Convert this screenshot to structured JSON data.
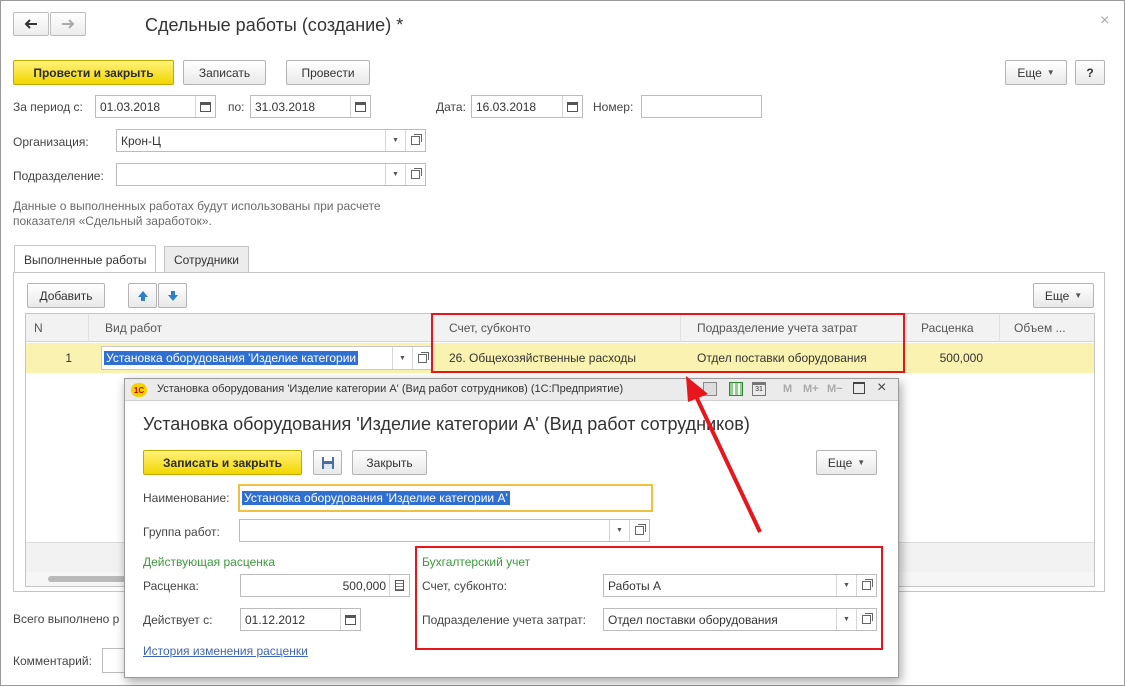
{
  "main": {
    "title": "Сдельные работы (создание) *",
    "buttons": {
      "post_close": "Провести и закрыть",
      "save": "Записать",
      "post": "Провести",
      "more": "Еще",
      "help": "?"
    },
    "period_label": "За период с:",
    "period_from": "01.03.2018",
    "period_to_label": "по:",
    "period_to": "31.03.2018",
    "date_label": "Дата:",
    "date_value": "16.03.2018",
    "number_label": "Номер:",
    "number_value": "",
    "org_label": "Организация:",
    "org_value": "Крон-Ц",
    "division_label": "Подразделение:",
    "division_value": "",
    "note": "Данные о выполненных работах будут использованы при расчете показателя «Сдельный заработок».",
    "tabs": [
      "Выполненные работы",
      "Сотрудники"
    ],
    "add_label": "Добавить",
    "table_more": "Еще",
    "columns": [
      "N",
      "Вид работ",
      "Счет, субконто",
      "Подразделение учета затрат",
      "Расценка",
      "Объем ..."
    ],
    "row": {
      "n": "1",
      "work_type": "Установка оборудования 'Изделие категории",
      "account": "26. Общехозяйственные расходы",
      "cost_division": "Отдел поставки оборудования",
      "rate": "500,000",
      "volume": ""
    },
    "total_label": "Всего выполнено р",
    "comment_label": "Комментарий:"
  },
  "dialog": {
    "window_title": "Установка оборудования 'Изделие категории А' (Вид работ сотрудников)  (1С:Предприятие)",
    "header": "Установка оборудования 'Изделие категории А' (Вид работ сотрудников)",
    "toolbar_icons": [
      "M",
      "M+",
      "M−"
    ],
    "buttons": {
      "save_close": "Записать и закрыть",
      "close": "Закрыть",
      "more": "Еще"
    },
    "name_label": "Наименование:",
    "name_value": "Установка оборудования 'Изделие категории А'",
    "group_label": "Группа работ:",
    "group_value": "",
    "rate_section": "Действующая расценка",
    "rate_label": "Расценка:",
    "rate_value": "500,000",
    "valid_label": "Действует с:",
    "valid_value": "01.12.2012",
    "history_link": "История изменения расценки",
    "acc_section": "Бухгалтерский учет",
    "account_label": "Счет, субконто:",
    "account_value": "Работы А",
    "cost_div_label": "Подразделение учета затрат:",
    "cost_div_value": "Отдел поставки оборудования"
  },
  "colors": {
    "accent_yellow": "#f2d600",
    "highlight_red": "#e8151c",
    "selection_blue": "#2e6fd1",
    "row_yellow": "#faf2b0",
    "section_green": "#3c9a3c"
  }
}
